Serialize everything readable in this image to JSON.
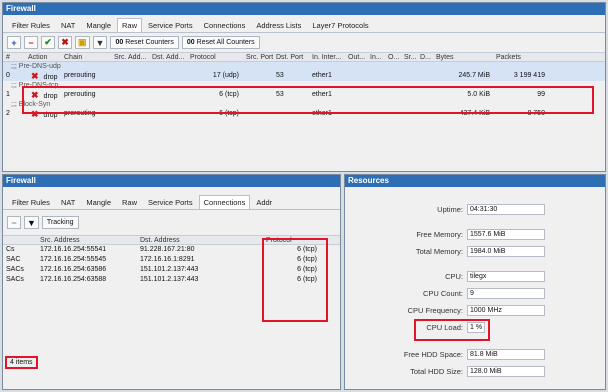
{
  "top": {
    "title": "Firewall",
    "tabs": [
      "Filter Rules",
      "NAT",
      "Mangle",
      "Raw",
      "Service Ports",
      "Connections",
      "Address Lists",
      "Layer7 Protocols"
    ],
    "reset_counters": "Reset Counters",
    "reset_all_counters": "Reset All Counters",
    "columns": [
      "#",
      "Action",
      "Chain",
      "Src. Add...",
      "Dst. Add...",
      "Protocol",
      "Src. Port",
      "Dst. Port",
      "In. Inter...",
      "Out...",
      "In...",
      "O...",
      "Sr...",
      "D...",
      "Bytes",
      "Packets"
    ],
    "rules": [
      {
        "comment": ";;; Pre-DNS-udp",
        "num": "0",
        "action": "drop",
        "chain": "prerouting",
        "protocol": "17 (udp)",
        "dst_port": "53",
        "in_iface": "ether1",
        "bytes": "245.7 MiB",
        "packets": "3 199 419"
      },
      {
        "comment": ";;; Pre-DNS-tcp",
        "num": "1",
        "action": "drop",
        "chain": "prerouting",
        "protocol": "6 (tcp)",
        "dst_port": "53",
        "in_iface": "ether1",
        "bytes": "5.0 KiB",
        "packets": "99"
      },
      {
        "comment": ";;; Block-Syn",
        "num": "2",
        "action": "drop",
        "chain": "prerouting",
        "protocol": "6 (tcp)",
        "dst_port": "",
        "in_iface": "ether1",
        "bytes": "437.4 KiB",
        "packets": "8 750"
      }
    ]
  },
  "bottom_left": {
    "title": "Firewall",
    "tabs": [
      "Filter Rules",
      "NAT",
      "Mangle",
      "Raw",
      "Service Ports",
      "Connections",
      "Addr"
    ],
    "tracking": "Tracking",
    "columns": [
      "",
      "Src. Address",
      "Dst. Address",
      "Protocol"
    ],
    "connections": [
      {
        "flag": "Cs",
        "src": "172.16.16.254:55541",
        "dst": "91.228.167.21:80",
        "proto": "6 (tcp)"
      },
      {
        "flag": "SAC",
        "src": "172.16.16.254:55545",
        "dst": "172.16.16.1:8291",
        "proto": "6 (tcp)"
      },
      {
        "flag": "SACs",
        "src": "172.16.16.254:63586",
        "dst": "151.101.2.137:443",
        "proto": "6 (tcp)"
      },
      {
        "flag": "SACs",
        "src": "172.16.16.254:63588",
        "dst": "151.101.2.137:443",
        "proto": "6 (tcp)"
      }
    ],
    "items_count": "4 items"
  },
  "resources": {
    "title": "Resources",
    "rows": [
      {
        "label": "Uptime:",
        "value": "04:31:30"
      },
      {
        "label": "Free Memory:",
        "value": "1557.6 MiB"
      },
      {
        "label": "Total Memory:",
        "value": "1984.0 MiB"
      },
      {
        "label": "CPU:",
        "value": "tilegx"
      },
      {
        "label": "CPU Count:",
        "value": "9"
      },
      {
        "label": "CPU Frequency:",
        "value": "1000 MHz"
      },
      {
        "label": "CPU Load:",
        "value": "1 %"
      },
      {
        "label": "Free HDD Space:",
        "value": "81.8 MiB"
      },
      {
        "label": "Total HDD Size:",
        "value": "128.0 MiB"
      }
    ]
  },
  "colors": {
    "titlebar": "#2e6eb5",
    "highlight": "#e0152a",
    "selected_row": "#d6e3f5"
  },
  "icons": [
    "plus-icon",
    "minus-icon",
    "check-icon",
    "x-icon",
    "comment-icon",
    "filter-icon"
  ]
}
